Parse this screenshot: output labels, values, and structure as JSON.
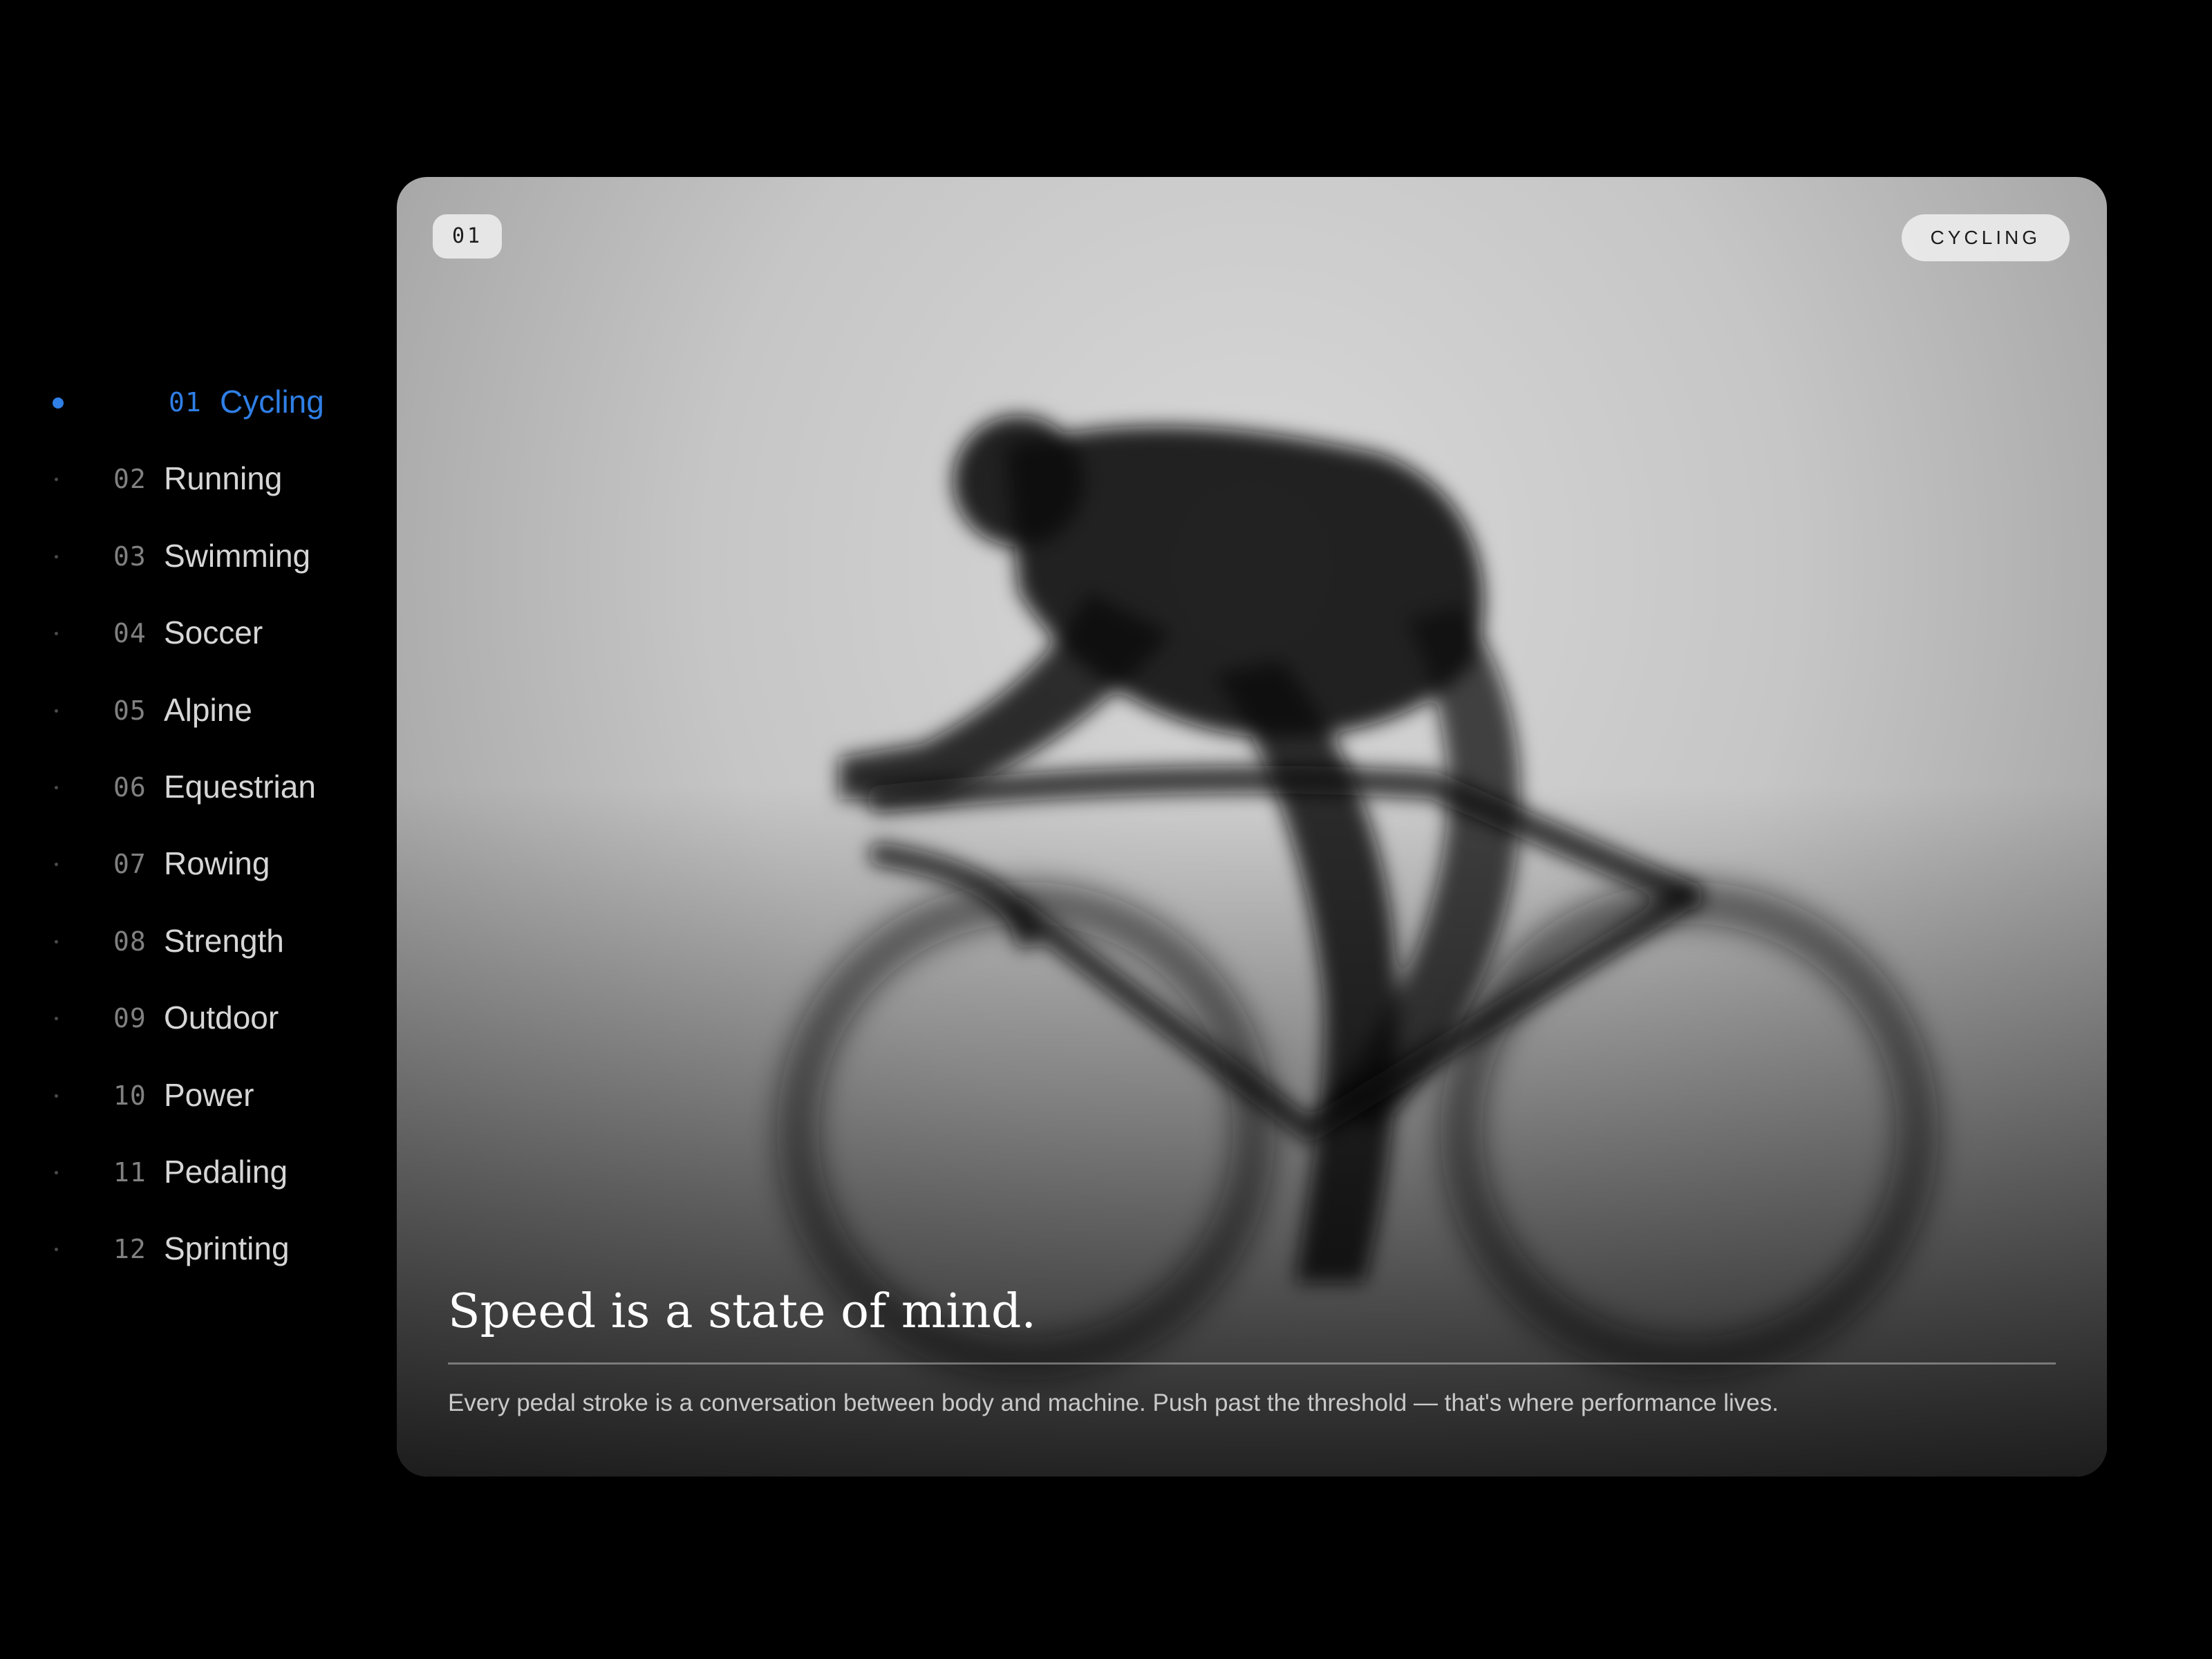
{
  "nav": {
    "active_index": 0,
    "items": [
      {
        "num": "01",
        "label": "Cycling"
      },
      {
        "num": "02",
        "label": "Running"
      },
      {
        "num": "03",
        "label": "Swimming"
      },
      {
        "num": "04",
        "label": "Soccer"
      },
      {
        "num": "05",
        "label": "Alpine"
      },
      {
        "num": "06",
        "label": "Equestrian"
      },
      {
        "num": "07",
        "label": "Rowing"
      },
      {
        "num": "08",
        "label": "Strength"
      },
      {
        "num": "09",
        "label": "Outdoor"
      },
      {
        "num": "10",
        "label": "Power"
      },
      {
        "num": "11",
        "label": "Pedaling"
      },
      {
        "num": "12",
        "label": "Sprinting"
      }
    ]
  },
  "card": {
    "index_badge": "01",
    "category_badge": "CYCLING",
    "headline": "Speed is a state of mind.",
    "body": "Every pedal stroke is a conversation between body and machine. Push past the threshold — that's where performance lives.",
    "image_subject": "blurred-cyclist-silhouette"
  },
  "colors": {
    "accent": "#2f7fe6",
    "background": "#000000",
    "nav_text": "#d6d6d6",
    "nav_number": "#808080"
  }
}
